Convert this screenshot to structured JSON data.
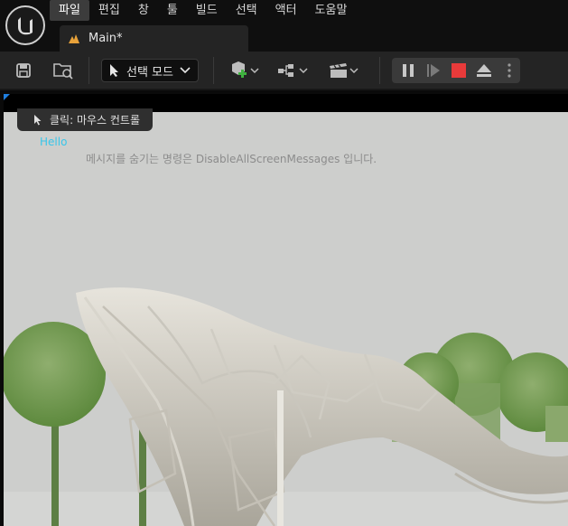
{
  "menu": {
    "items": [
      "파일",
      "편집",
      "창",
      "툴",
      "빌드",
      "선택",
      "액터",
      "도움말"
    ],
    "active_index": 0
  },
  "document_tab": {
    "label": "Main*"
  },
  "toolbar": {
    "mode_label": "선택 모드"
  },
  "viewport": {
    "click_hint": "클릭: 마우스 컨트롤",
    "message_hello": "Hello",
    "message_hint": "메시지를 숨기는 명령은 DisableAllScreenMessages 입니다."
  },
  "colors": {
    "accent_blue": "#1f7fe0",
    "stop_red": "#e83a3a",
    "hello_cyan": "#37c6ea"
  }
}
